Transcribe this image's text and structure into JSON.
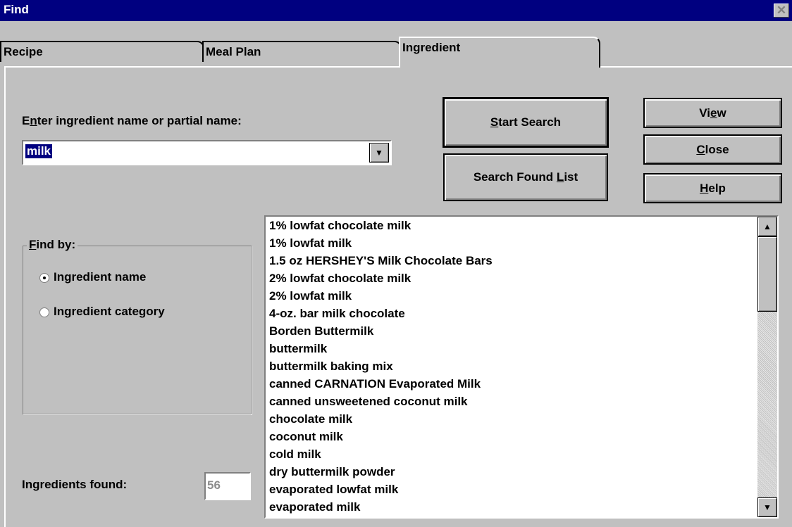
{
  "window": {
    "title": "Find",
    "close_glyph": "✕"
  },
  "tabs": [
    {
      "label": "Recipe",
      "active": false
    },
    {
      "label": "Meal Plan",
      "active": false
    },
    {
      "label": "Ingredient",
      "active": true
    }
  ],
  "search": {
    "label_prefix": "E",
    "label_mnemonic": "n",
    "label_suffix": "ter ingredient name or partial name:",
    "value": "milk",
    "dropdown_icon": "▼"
  },
  "buttons": {
    "start_search": {
      "mnemonic": "S",
      "rest": "tart Search"
    },
    "search_found_list": {
      "prefix": "Search Found ",
      "mnemonic": "L",
      "rest": "ist"
    },
    "view": {
      "prefix": "Vi",
      "mnemonic": "e",
      "rest": "w"
    },
    "close": {
      "mnemonic": "C",
      "rest": "lose"
    },
    "help": {
      "mnemonic": "H",
      "rest": "elp"
    }
  },
  "find_by": {
    "label_mnemonic": "F",
    "label_rest": "ind by:",
    "options": [
      {
        "label": "Ingredient name",
        "selected": true
      },
      {
        "label": "Ingredient category",
        "selected": false
      }
    ]
  },
  "results": {
    "items": [
      "1% lowfat chocolate milk",
      "1% lowfat milk",
      "1.5 oz HERSHEY'S Milk Chocolate Bars",
      "2% lowfat chocolate milk",
      "2% lowfat milk",
      "4-oz. bar milk chocolate",
      "Borden Buttermilk",
      "buttermilk",
      "buttermilk baking mix",
      "canned CARNATION Evaporated Milk",
      "canned unsweetened coconut milk",
      "chocolate milk",
      "coconut milk",
      "cold milk",
      "dry buttermilk powder",
      "evaporated lowfat milk",
      "evaporated milk"
    ],
    "scroll_up_icon": "▲",
    "scroll_down_icon": "▼"
  },
  "count": {
    "label": "Ingredients found:",
    "value": "56"
  }
}
